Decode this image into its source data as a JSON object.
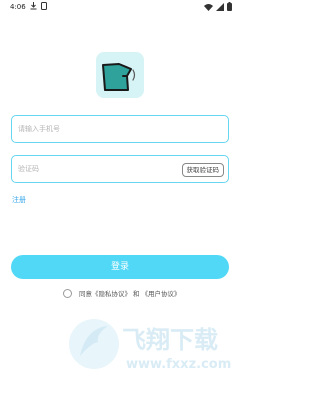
{
  "status_bar": {
    "time": "4:06",
    "left_icons": [
      "download-icon",
      "notification-icon"
    ],
    "right_icons": [
      "wifi-icon",
      "signal-icon",
      "battery-icon"
    ]
  },
  "logo": {
    "icon": "app-logo-icon"
  },
  "form": {
    "phone_placeholder": "请输入手机号",
    "code_placeholder": "验证码",
    "get_code_label": "获取验证码",
    "register_label": "注册",
    "login_label": "登录"
  },
  "agreement": {
    "prefix": "同意",
    "privacy": "《隐私协议》",
    "joiner": "和",
    "user": "《用户协议》"
  },
  "watermark": {
    "title": "飞翔下载",
    "url": "www.fxxz.com"
  },
  "colors": {
    "accent": "#51d8f6",
    "border": "#67d6ef",
    "link": "#3aa7e8",
    "logo_bg": "#d6f3f5",
    "logo_fg": "#2fa39b"
  }
}
